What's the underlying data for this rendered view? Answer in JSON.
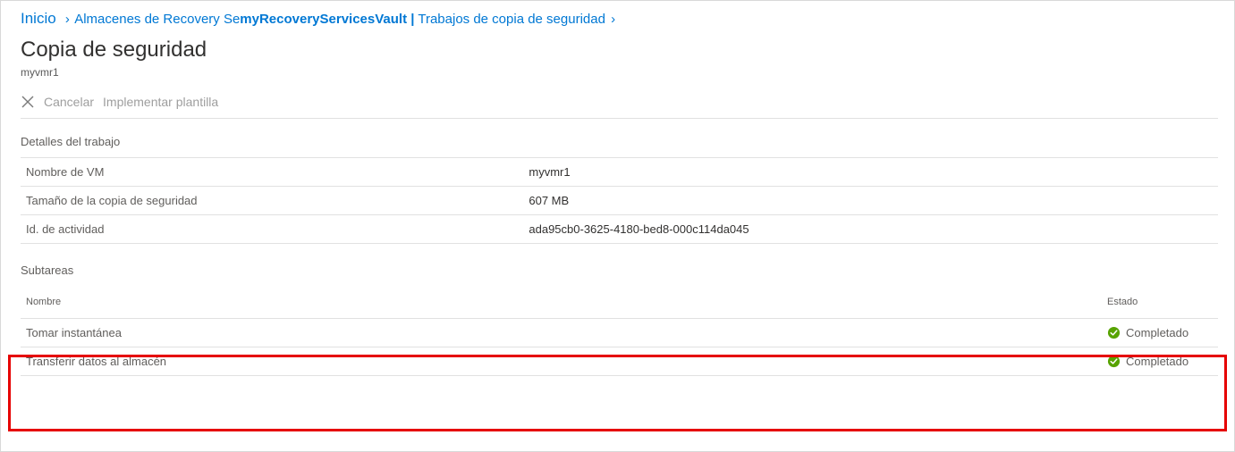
{
  "breadcrumb": {
    "home": "Inicio",
    "items": [
      "Almacenes de Recovery Se",
      "myRecoveryServicesVault |",
      "Trabajos de copia de seguridad"
    ]
  },
  "header": {
    "title": "Copia de seguridad",
    "subtitle": "myvmr1"
  },
  "toolbar": {
    "cancel": "Cancelar",
    "template": "Implementar  plantilla"
  },
  "details": {
    "section_label": "Detalles del trabajo",
    "rows": [
      {
        "key": "Nombre de VM",
        "value": "myvmr1"
      },
      {
        "key": "Tamaño de la copia de seguridad",
        "value": "607 MB"
      },
      {
        "key": "Id. de actividad",
        "value": "ada95cb0-3625-4180-bed8-000c114da045"
      }
    ]
  },
  "subtasks": {
    "section_label": "Subtareas",
    "columns": {
      "name": "Nombre",
      "status": "Estado"
    },
    "rows": [
      {
        "name": "Tomar instantánea",
        "status": "Completado",
        "status_icon": "success"
      },
      {
        "name": "Transferir datos al almacén",
        "status": "Completado",
        "status_icon": "success"
      }
    ]
  },
  "colors": {
    "link": "#0078d4",
    "success": "#57A300",
    "highlight": "#e60000"
  }
}
